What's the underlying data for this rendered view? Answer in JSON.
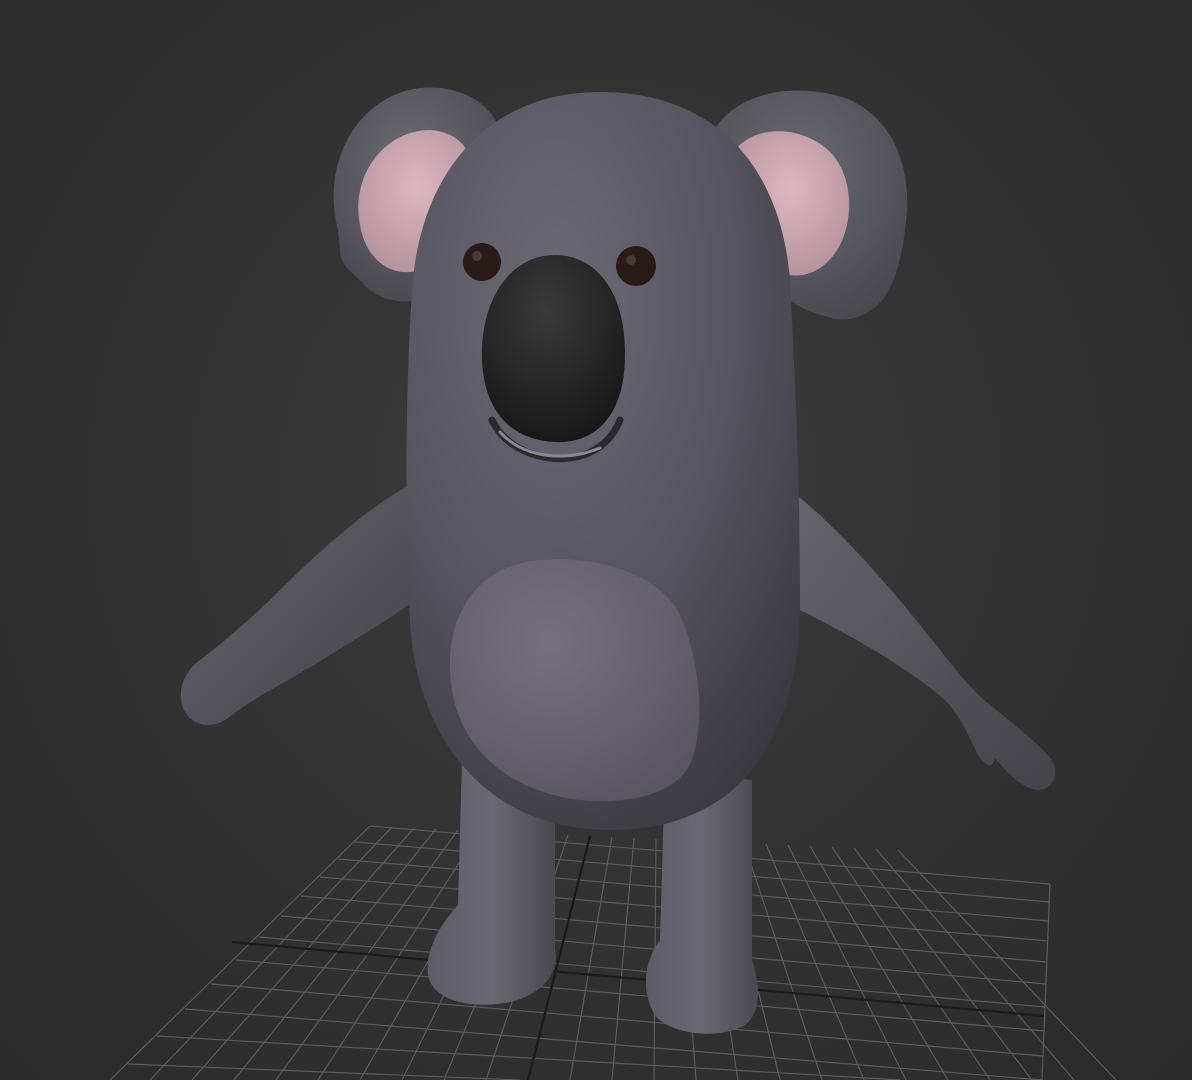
{
  "viewport": {
    "background_color": "#353535",
    "grid_color": "#5c5c5c",
    "grid_axis_color": "#1a1a1a",
    "model": {
      "name": "koala character",
      "body_color": "#5a5862",
      "belly_color": "#6e6872",
      "inner_ear_color": "#c9a3ad",
      "nose_color": "#222222",
      "eye_color": "#2a1a18"
    }
  }
}
